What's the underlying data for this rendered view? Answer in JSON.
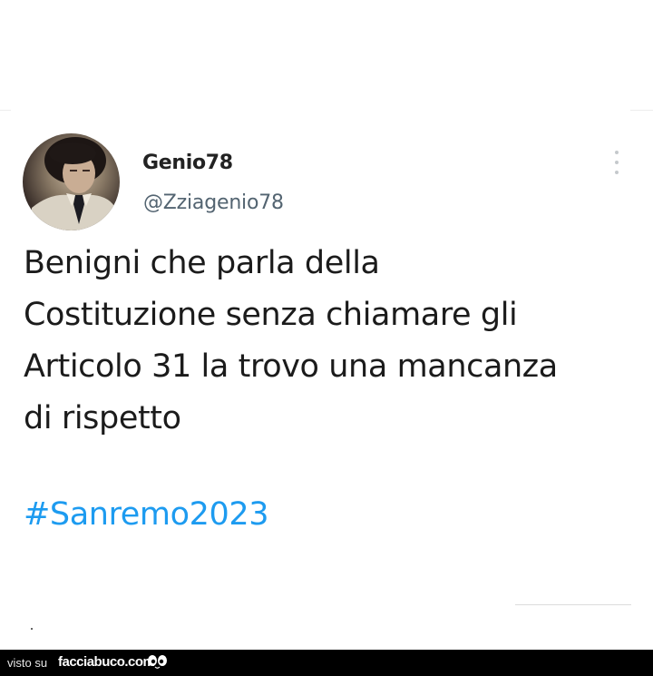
{
  "tweet": {
    "display_name": "Genio78",
    "handle": "@Zziagenio78",
    "text_lines": [
      "Benigni che parla della",
      "Costituzione senza chiamare gli",
      "Articolo 31 la trovo una mancanza",
      "di rispetto"
    ],
    "hashtag": "#Sanremo2023",
    "icons": {
      "more": "more-vertical-icon",
      "avatar": "avatar"
    }
  },
  "colors": {
    "hashtag": "#1d9bf0",
    "handle": "#536471",
    "footer_bg": "#000000"
  },
  "footer": {
    "prefix": "visto su",
    "site": "facciabuco.com",
    "logo_icon": "facciabuco-eyes-icon"
  }
}
